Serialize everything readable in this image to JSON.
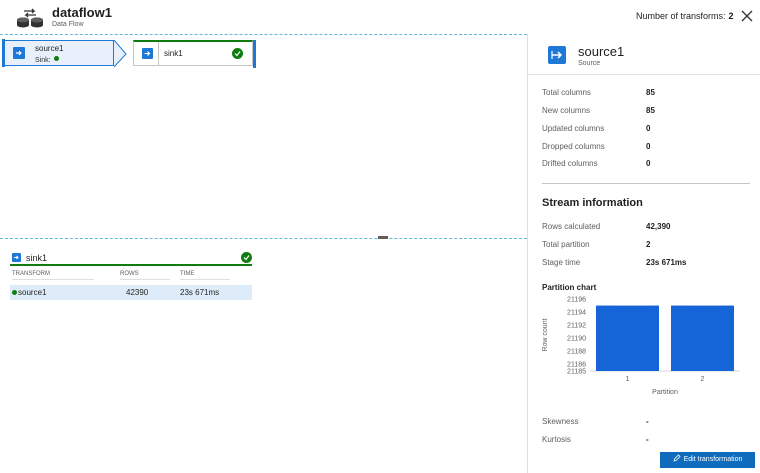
{
  "header": {
    "title": "dataflow1",
    "subtitle": "Data Flow",
    "transforms_label": "Number of transforms:",
    "transforms_count": "2"
  },
  "canvas": {
    "source_node": {
      "name": "source1",
      "sub": "Sink:"
    },
    "sink_node": {
      "name": "sink1"
    }
  },
  "sink_panel": {
    "title": "sink1",
    "columns": [
      "TRANSFORM",
      "ROWS",
      "TIME"
    ],
    "rows": [
      {
        "transform": "source1",
        "rows": "42390",
        "time": "23s 671ms"
      }
    ]
  },
  "right_panel": {
    "title": "source1",
    "subtitle": "Source",
    "stats": [
      {
        "label": "Total columns",
        "value": "85"
      },
      {
        "label": "New columns",
        "value": "85"
      },
      {
        "label": "Updated columns",
        "value": "0"
      },
      {
        "label": "Dropped columns",
        "value": "0"
      },
      {
        "label": "Drifted columns",
        "value": "0"
      }
    ],
    "stream_title": "Stream information",
    "stream": [
      {
        "label": "Rows calculated",
        "value": "42,390"
      },
      {
        "label": "Total partition",
        "value": "2"
      },
      {
        "label": "Stage time",
        "value": "23s 671ms"
      }
    ],
    "chart_title": "Partition chart",
    "extra": [
      {
        "label": "Skewness",
        "value": "-"
      },
      {
        "label": "Kurtosis",
        "value": "-"
      }
    ],
    "edit_button": "Edit transformation"
  },
  "colors": {
    "accent": "#0f6cbd",
    "success": "#107c10",
    "bar": "#1565d8"
  },
  "chart_data": {
    "type": "bar",
    "categories": [
      "1",
      "2"
    ],
    "values": [
      21195,
      21195
    ],
    "xlabel": "Partition",
    "ylabel": "Row count",
    "yticks": [
      "21196",
      "21194",
      "21192",
      "21190",
      "21188",
      "21186",
      "21185"
    ],
    "ylim": [
      21185,
      21196
    ]
  }
}
